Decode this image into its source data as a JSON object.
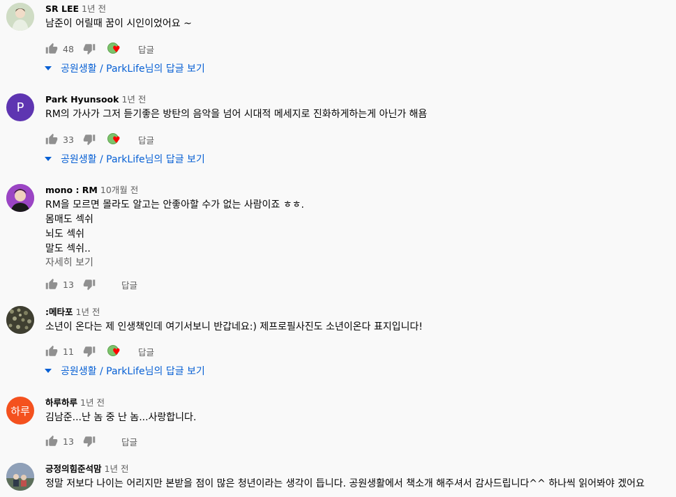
{
  "comments": [
    {
      "author": "SR LEE",
      "time": "1년 전",
      "text": "남준이 어릴때 꿈이 시인이었어요 ~",
      "likes": "48",
      "reply_label": "답글",
      "creator_heart": true,
      "view_replies": {
        "channel": "공원생활 / ParkLife",
        "suffix": "님의 답글 보기"
      },
      "avatar_color": "#b8c8a8"
    },
    {
      "author": "Park Hyunsook",
      "time": "1년 전",
      "text": "RM의 가사가  그저 듣기좋은 방탄의 음악을 넘어 시대적 메세지로 진화하게하는게 아닌가 해욤",
      "likes": "33",
      "reply_label": "답글",
      "creator_heart": true,
      "view_replies": {
        "channel": "공원생활 / ParkLife",
        "suffix": "님의 답글 보기"
      },
      "avatar_letter": "P",
      "avatar_color": "#5e35b1"
    },
    {
      "author": "mono : RM",
      "time": "10개월 전",
      "text": "RM을 모르면 몰라도 알고는 안좋아할 수가 없는 사람이죠 ㅎㅎ.\n몸매도 섹쉬\n뇌도 섹쉬\n말도 섹쉬..",
      "read_more": "자세히 보기",
      "likes": "13",
      "reply_label": "답글",
      "creator_heart": false,
      "avatar_color": "#8e3fb5"
    },
    {
      "author": ":메타포",
      "time": "1년 전",
      "text": "소년이 온다는 제 인생책인데 여기서보니 반갑네요:) 제프로필사진도 소년이온다 표지입니다!",
      "likes": "11",
      "reply_label": "답글",
      "creator_heart": true,
      "view_replies": {
        "channel": "공원생활 / ParkLife",
        "suffix": "님의 답글 보기"
      },
      "avatar_color": "#4a4a3a"
    },
    {
      "author": "하루하루",
      "time": "1년 전",
      "text": "김남준...난 놈 중 난 놈...사랑합니다.",
      "likes": "13",
      "reply_label": "답글",
      "creator_heart": false,
      "avatar_letter": "하루",
      "avatar_color": "#f4511e"
    },
    {
      "author": "긍정의힘준석맘",
      "time": "1년 전",
      "text": "정말 저보다 나이는 어리지만 본받을 점이 많은 청년이라는 생각이 듭니다. 공원생활에서 책소개 해주셔서 감사드립니다^^ 하나씩 읽어봐야 겠어요",
      "avatar_color": "#7a8aa0"
    }
  ],
  "colors": {
    "background": "#f9f9f9",
    "link": "#065fd4",
    "secondary_text": "#606060",
    "heart": "#ff0000"
  },
  "icons": {
    "like": "thumb-up-icon",
    "dislike": "thumb-down-icon",
    "expand": "caret-down-icon",
    "heart": "creator-heart-icon"
  }
}
